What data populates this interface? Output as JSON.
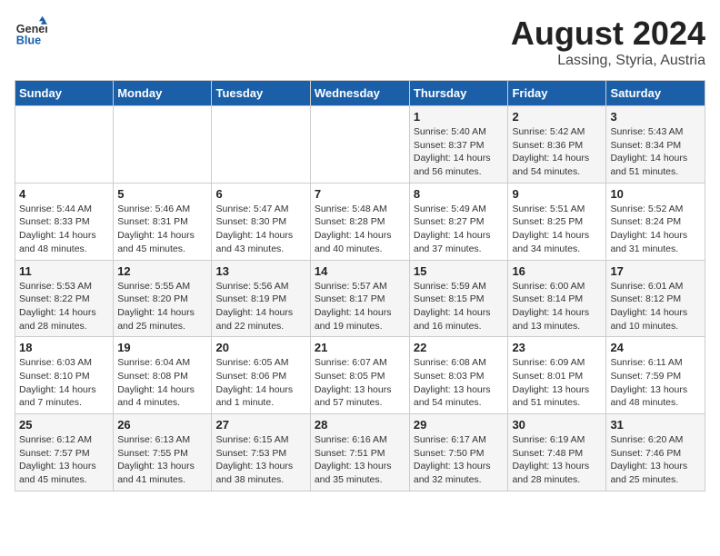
{
  "header": {
    "logo_general": "General",
    "logo_blue": "Blue",
    "main_title": "August 2024",
    "subtitle": "Lassing, Styria, Austria"
  },
  "weekdays": [
    "Sunday",
    "Monday",
    "Tuesday",
    "Wednesday",
    "Thursday",
    "Friday",
    "Saturday"
  ],
  "weeks": [
    [
      {
        "day": "",
        "sunrise": "",
        "sunset": "",
        "daylight": ""
      },
      {
        "day": "",
        "sunrise": "",
        "sunset": "",
        "daylight": ""
      },
      {
        "day": "",
        "sunrise": "",
        "sunset": "",
        "daylight": ""
      },
      {
        "day": "",
        "sunrise": "",
        "sunset": "",
        "daylight": ""
      },
      {
        "day": "1",
        "sunrise": "Sunrise: 5:40 AM",
        "sunset": "Sunset: 8:37 PM",
        "daylight": "Daylight: 14 hours and 56 minutes."
      },
      {
        "day": "2",
        "sunrise": "Sunrise: 5:42 AM",
        "sunset": "Sunset: 8:36 PM",
        "daylight": "Daylight: 14 hours and 54 minutes."
      },
      {
        "day": "3",
        "sunrise": "Sunrise: 5:43 AM",
        "sunset": "Sunset: 8:34 PM",
        "daylight": "Daylight: 14 hours and 51 minutes."
      }
    ],
    [
      {
        "day": "4",
        "sunrise": "Sunrise: 5:44 AM",
        "sunset": "Sunset: 8:33 PM",
        "daylight": "Daylight: 14 hours and 48 minutes."
      },
      {
        "day": "5",
        "sunrise": "Sunrise: 5:46 AM",
        "sunset": "Sunset: 8:31 PM",
        "daylight": "Daylight: 14 hours and 45 minutes."
      },
      {
        "day": "6",
        "sunrise": "Sunrise: 5:47 AM",
        "sunset": "Sunset: 8:30 PM",
        "daylight": "Daylight: 14 hours and 43 minutes."
      },
      {
        "day": "7",
        "sunrise": "Sunrise: 5:48 AM",
        "sunset": "Sunset: 8:28 PM",
        "daylight": "Daylight: 14 hours and 40 minutes."
      },
      {
        "day": "8",
        "sunrise": "Sunrise: 5:49 AM",
        "sunset": "Sunset: 8:27 PM",
        "daylight": "Daylight: 14 hours and 37 minutes."
      },
      {
        "day": "9",
        "sunrise": "Sunrise: 5:51 AM",
        "sunset": "Sunset: 8:25 PM",
        "daylight": "Daylight: 14 hours and 34 minutes."
      },
      {
        "day": "10",
        "sunrise": "Sunrise: 5:52 AM",
        "sunset": "Sunset: 8:24 PM",
        "daylight": "Daylight: 14 hours and 31 minutes."
      }
    ],
    [
      {
        "day": "11",
        "sunrise": "Sunrise: 5:53 AM",
        "sunset": "Sunset: 8:22 PM",
        "daylight": "Daylight: 14 hours and 28 minutes."
      },
      {
        "day": "12",
        "sunrise": "Sunrise: 5:55 AM",
        "sunset": "Sunset: 8:20 PM",
        "daylight": "Daylight: 14 hours and 25 minutes."
      },
      {
        "day": "13",
        "sunrise": "Sunrise: 5:56 AM",
        "sunset": "Sunset: 8:19 PM",
        "daylight": "Daylight: 14 hours and 22 minutes."
      },
      {
        "day": "14",
        "sunrise": "Sunrise: 5:57 AM",
        "sunset": "Sunset: 8:17 PM",
        "daylight": "Daylight: 14 hours and 19 minutes."
      },
      {
        "day": "15",
        "sunrise": "Sunrise: 5:59 AM",
        "sunset": "Sunset: 8:15 PM",
        "daylight": "Daylight: 14 hours and 16 minutes."
      },
      {
        "day": "16",
        "sunrise": "Sunrise: 6:00 AM",
        "sunset": "Sunset: 8:14 PM",
        "daylight": "Daylight: 14 hours and 13 minutes."
      },
      {
        "day": "17",
        "sunrise": "Sunrise: 6:01 AM",
        "sunset": "Sunset: 8:12 PM",
        "daylight": "Daylight: 14 hours and 10 minutes."
      }
    ],
    [
      {
        "day": "18",
        "sunrise": "Sunrise: 6:03 AM",
        "sunset": "Sunset: 8:10 PM",
        "daylight": "Daylight: 14 hours and 7 minutes."
      },
      {
        "day": "19",
        "sunrise": "Sunrise: 6:04 AM",
        "sunset": "Sunset: 8:08 PM",
        "daylight": "Daylight: 14 hours and 4 minutes."
      },
      {
        "day": "20",
        "sunrise": "Sunrise: 6:05 AM",
        "sunset": "Sunset: 8:06 PM",
        "daylight": "Daylight: 14 hours and 1 minute."
      },
      {
        "day": "21",
        "sunrise": "Sunrise: 6:07 AM",
        "sunset": "Sunset: 8:05 PM",
        "daylight": "Daylight: 13 hours and 57 minutes."
      },
      {
        "day": "22",
        "sunrise": "Sunrise: 6:08 AM",
        "sunset": "Sunset: 8:03 PM",
        "daylight": "Daylight: 13 hours and 54 minutes."
      },
      {
        "day": "23",
        "sunrise": "Sunrise: 6:09 AM",
        "sunset": "Sunset: 8:01 PM",
        "daylight": "Daylight: 13 hours and 51 minutes."
      },
      {
        "day": "24",
        "sunrise": "Sunrise: 6:11 AM",
        "sunset": "Sunset: 7:59 PM",
        "daylight": "Daylight: 13 hours and 48 minutes."
      }
    ],
    [
      {
        "day": "25",
        "sunrise": "Sunrise: 6:12 AM",
        "sunset": "Sunset: 7:57 PM",
        "daylight": "Daylight: 13 hours and 45 minutes."
      },
      {
        "day": "26",
        "sunrise": "Sunrise: 6:13 AM",
        "sunset": "Sunset: 7:55 PM",
        "daylight": "Daylight: 13 hours and 41 minutes."
      },
      {
        "day": "27",
        "sunrise": "Sunrise: 6:15 AM",
        "sunset": "Sunset: 7:53 PM",
        "daylight": "Daylight: 13 hours and 38 minutes."
      },
      {
        "day": "28",
        "sunrise": "Sunrise: 6:16 AM",
        "sunset": "Sunset: 7:51 PM",
        "daylight": "Daylight: 13 hours and 35 minutes."
      },
      {
        "day": "29",
        "sunrise": "Sunrise: 6:17 AM",
        "sunset": "Sunset: 7:50 PM",
        "daylight": "Daylight: 13 hours and 32 minutes."
      },
      {
        "day": "30",
        "sunrise": "Sunrise: 6:19 AM",
        "sunset": "Sunset: 7:48 PM",
        "daylight": "Daylight: 13 hours and 28 minutes."
      },
      {
        "day": "31",
        "sunrise": "Sunrise: 6:20 AM",
        "sunset": "Sunset: 7:46 PM",
        "daylight": "Daylight: 13 hours and 25 minutes."
      }
    ]
  ]
}
